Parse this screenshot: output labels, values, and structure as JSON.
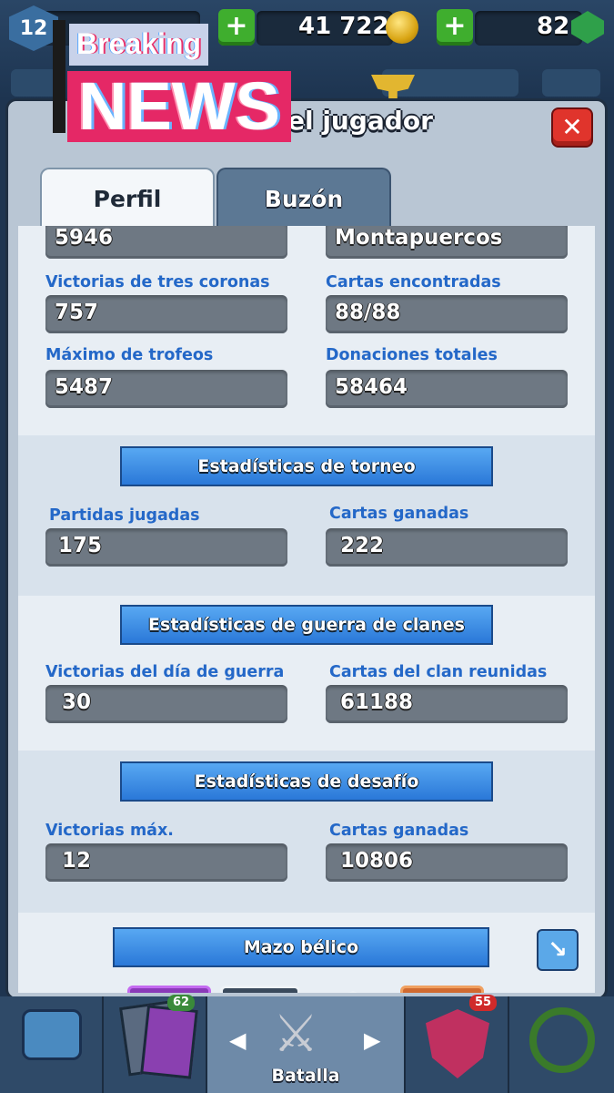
{
  "hud": {
    "level": "12",
    "name_obscured": "",
    "gold": "41 722",
    "gems": "82",
    "trophies": ""
  },
  "overlay": {
    "top": "Breaking",
    "main": "NEWS"
  },
  "panel": {
    "title": "el jugador",
    "close_icon": "close-icon"
  },
  "tabs": [
    {
      "label": "Perfil",
      "active": true
    },
    {
      "label": "Buzón",
      "active": false
    }
  ],
  "stats": {
    "top_left_value": "5946",
    "top_right_value": "Montapuercos",
    "three_crown_label": "Victorias de tres coronas",
    "three_crown_value": "757",
    "cards_found_label": "Cartas encontradas",
    "cards_found_value": "88/88",
    "max_trophies_label": "Máximo de trofeos",
    "max_trophies_value": "5487",
    "donations_label": "Donaciones totales",
    "donations_value": "58464"
  },
  "tournament": {
    "title": "Estadísticas de torneo",
    "played_label": "Partidas jugadas",
    "played_value": "175",
    "won_label": "Cartas ganadas",
    "won_value": "222"
  },
  "clan_war": {
    "title": "Estadísticas de guerra de clanes",
    "wins_label": "Victorias del día de guerra",
    "wins_value": "30",
    "cards_label": "Cartas del clan reunidas",
    "cards_value": "61188"
  },
  "challenge": {
    "title": "Estadísticas de desafío",
    "max_wins_label": "Victorias máx.",
    "max_wins_value": "12",
    "cards_label": "Cartas ganadas",
    "cards_value": "10806"
  },
  "war_deck": {
    "title": "Mazo bélico"
  },
  "nav": {
    "shop_icon": "chest-icon",
    "cards_icon": "cards-icon",
    "cards_badge": "62",
    "battle_label": "Batalla",
    "clan_icon": "clan-shield-icon",
    "clan_badge": "55",
    "tournament_icon": "laurel-sword-icon"
  },
  "colors": {
    "accent_blue": "#2468c8",
    "panel_bg": "#b9c6d4",
    "news_red": "#e52866",
    "close_red": "#e0342c"
  }
}
